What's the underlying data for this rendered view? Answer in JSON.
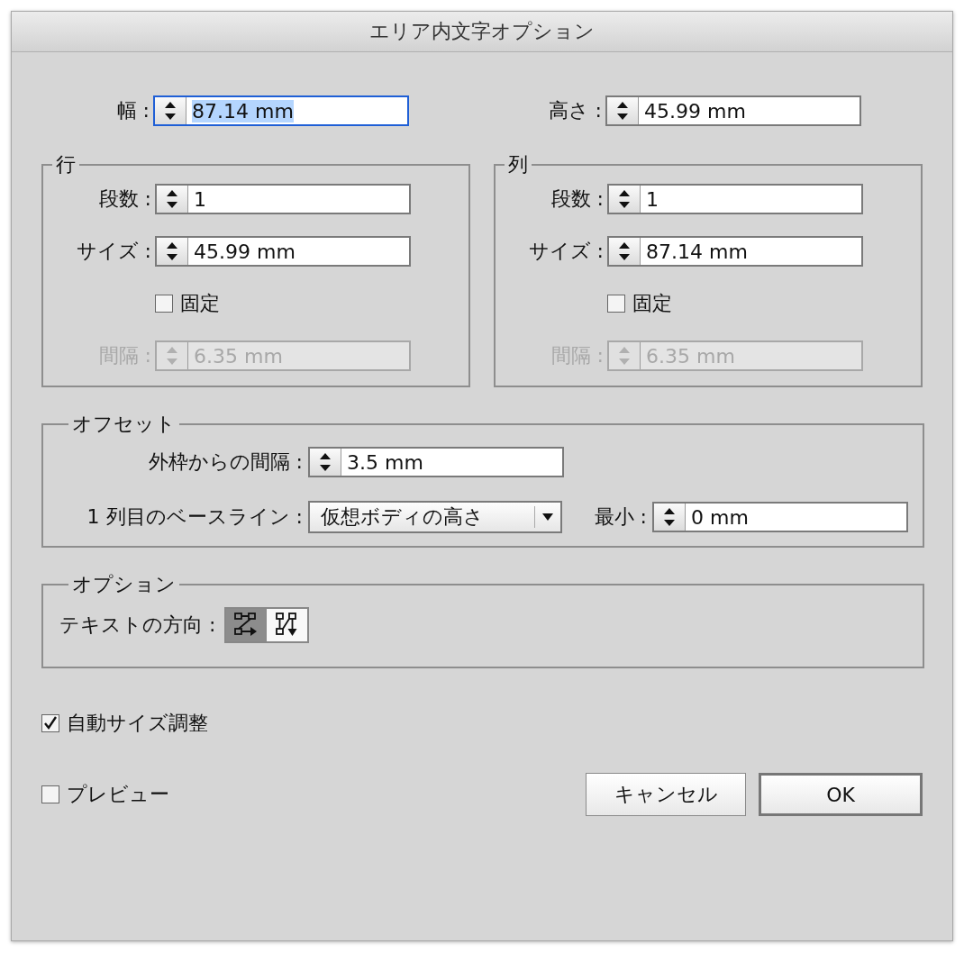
{
  "window": {
    "title": "エリア内文字オプション"
  },
  "top_fields": [
    {
      "label": "幅 :",
      "value": "87.14 mm",
      "focused": true
    },
    {
      "label": "高さ :",
      "value": "45.99 mm",
      "focused": false
    }
  ],
  "groups": [
    {
      "title": "行",
      "fields": [
        {
          "kind": "spin",
          "label": "段数 :",
          "value": "1",
          "disabled": false
        },
        {
          "kind": "spin",
          "label": "サイズ :",
          "value": "45.99 mm",
          "disabled": false
        },
        {
          "kind": "check",
          "label": "固定",
          "checked": false
        },
        {
          "kind": "spin",
          "label": "間隔 :",
          "value": "6.35 mm",
          "disabled": true
        }
      ]
    },
    {
      "title": "列",
      "fields": [
        {
          "kind": "spin",
          "label": "段数 :",
          "value": "1",
          "disabled": false
        },
        {
          "kind": "spin",
          "label": "サイズ :",
          "value": "87.14 mm",
          "disabled": false
        },
        {
          "kind": "check",
          "label": "固定",
          "checked": false
        },
        {
          "kind": "spin",
          "label": "間隔 :",
          "value": "6.35 mm",
          "disabled": true
        }
      ]
    }
  ],
  "offset": {
    "title": "オフセット",
    "inset": {
      "label": "外枠からの間隔 :",
      "value": "3.5 mm"
    },
    "first_baseline": {
      "label": "1 列目のベースライン :",
      "value": "仮想ボディの高さ"
    },
    "minimum": {
      "label": "最小 :",
      "value": "0 mm"
    }
  },
  "options": {
    "title": "オプション",
    "text_flow": {
      "label": "テキストの方向 :",
      "buttons": [
        {
          "kind": "horizontal",
          "selected": true
        },
        {
          "kind": "vertical",
          "selected": false
        }
      ]
    }
  },
  "auto_size": {
    "label": "自動サイズ調整",
    "checked": true
  },
  "preview": {
    "label": "プレビュー",
    "checked": false
  },
  "buttons": [
    {
      "label": "キャンセル",
      "kind": "cancel"
    },
    {
      "label": "OK",
      "kind": "default"
    }
  ]
}
